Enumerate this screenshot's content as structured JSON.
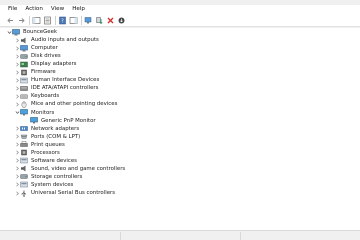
{
  "menu": [
    {
      "name": "menu-file",
      "label": "File"
    },
    {
      "name": "menu-action",
      "label": "Action"
    },
    {
      "name": "menu-view",
      "label": "View"
    },
    {
      "name": "menu-help",
      "label": "Help"
    }
  ],
  "toolbar": [
    {
      "name": "back-button",
      "icon": "back-arrow-icon"
    },
    {
      "name": "forward-button",
      "icon": "forward-arrow-icon"
    },
    {
      "sep": true
    },
    {
      "name": "show-hide-console-tree-button",
      "icon": "console-tree-icon"
    },
    {
      "name": "properties-button",
      "icon": "properties-icon"
    },
    {
      "sep": true
    },
    {
      "name": "help-button",
      "icon": "help-book-icon"
    },
    {
      "name": "action-pane-button",
      "icon": "action-pane-icon"
    },
    {
      "sep": true
    },
    {
      "name": "scan-hardware-button",
      "icon": "scan-monitor-icon"
    },
    {
      "name": "update-driver-button",
      "icon": "update-driver-icon"
    },
    {
      "name": "uninstall-device-button",
      "icon": "red-x-icon"
    },
    {
      "name": "disable-device-button",
      "icon": "download-arrow-icon"
    }
  ],
  "tree": {
    "root": {
      "label": "BounceGeek",
      "expanded": true,
      "icon": "computer-icon"
    },
    "items": [
      {
        "label": "Audio inputs and outputs",
        "icon": "speaker-icon",
        "expanded": false
      },
      {
        "label": "Computer",
        "icon": "computer-icon",
        "expanded": false
      },
      {
        "label": "Disk drives",
        "icon": "disk-drive-icon",
        "expanded": false
      },
      {
        "label": "Display adapters",
        "icon": "display-adapter-icon",
        "expanded": false
      },
      {
        "label": "Firmware",
        "icon": "firmware-icon",
        "expanded": false
      },
      {
        "label": "Human Interface Devices",
        "icon": "hid-icon",
        "expanded": false
      },
      {
        "label": "IDE ATA/ATAPI controllers",
        "icon": "ide-controller-icon",
        "expanded": false
      },
      {
        "label": "Keyboards",
        "icon": "keyboard-icon",
        "expanded": false
      },
      {
        "label": "Mice and other pointing devices",
        "icon": "mouse-icon",
        "expanded": false
      },
      {
        "label": "Monitors",
        "icon": "monitor-icon",
        "expanded": true,
        "children": [
          {
            "label": "Generic PnP Monitor",
            "icon": "monitor-icon"
          }
        ]
      },
      {
        "label": "Network adapters",
        "icon": "network-adapter-icon",
        "expanded": false
      },
      {
        "label": "Ports (COM & LPT)",
        "icon": "port-icon",
        "expanded": false
      },
      {
        "label": "Print queues",
        "icon": "printer-icon",
        "expanded": false
      },
      {
        "label": "Processors",
        "icon": "processor-icon",
        "expanded": false
      },
      {
        "label": "Software devices",
        "icon": "software-device-icon",
        "expanded": false
      },
      {
        "label": "Sound, video and game controllers",
        "icon": "sound-icon",
        "expanded": false
      },
      {
        "label": "Storage controllers",
        "icon": "storage-controller-icon",
        "expanded": false
      },
      {
        "label": "System devices",
        "icon": "system-device-icon",
        "expanded": false
      },
      {
        "label": "Universal Serial Bus controllers",
        "icon": "usb-icon",
        "expanded": false
      }
    ]
  },
  "colors": {
    "folder": "#3c6fb4",
    "red_x": "#d32f2f",
    "green": "#2e8b57"
  }
}
